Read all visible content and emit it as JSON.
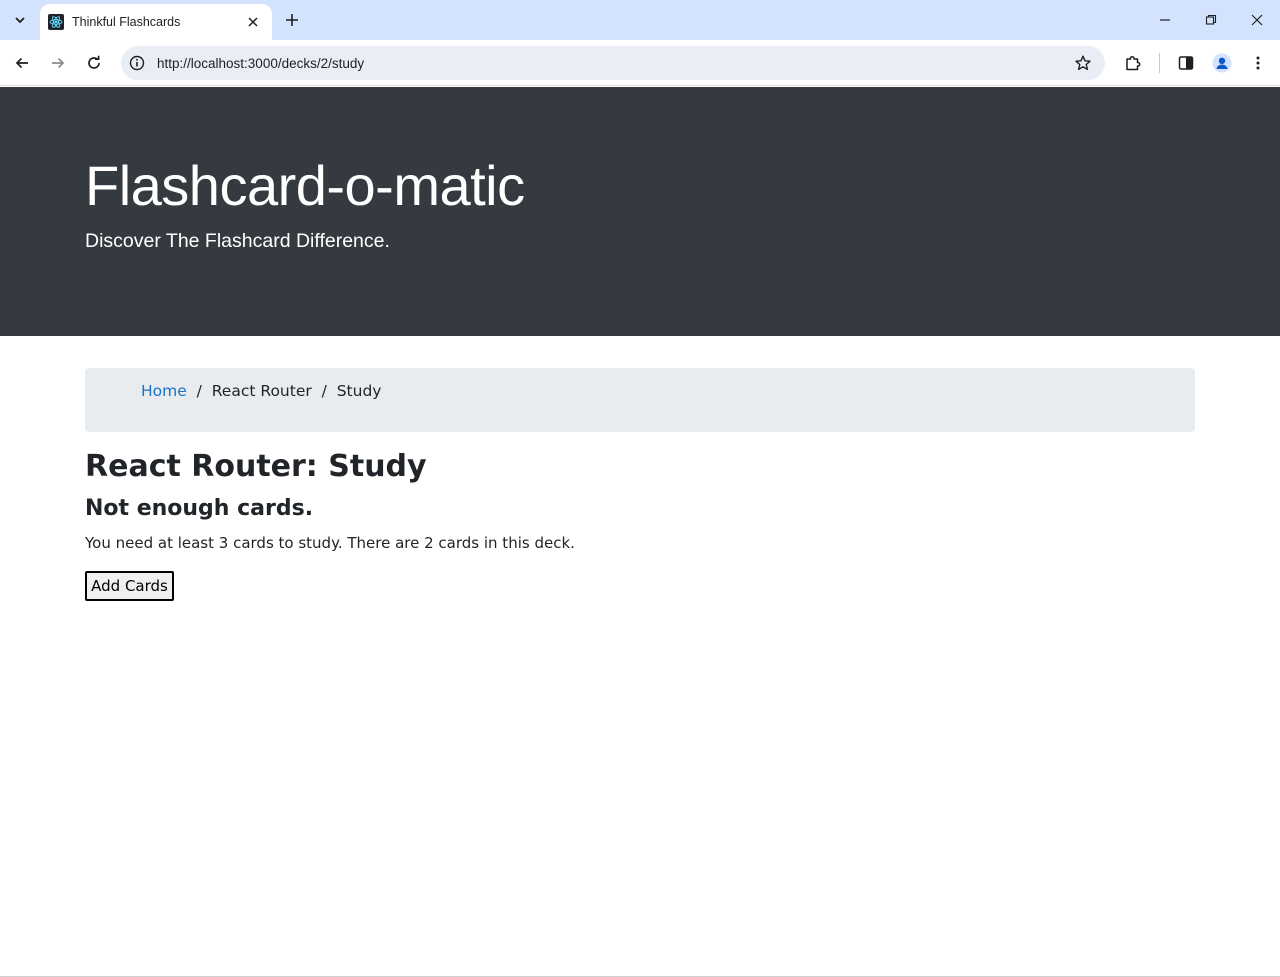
{
  "browser": {
    "tab_title": "Thinkful Flashcards",
    "url": "http://localhost:3000/decks/2/study",
    "icons": {
      "tab_search": "chevron-down-icon",
      "favicon": "react-logo-icon",
      "tab_close": "close-icon",
      "new_tab": "plus-icon",
      "back": "back-arrow-icon",
      "forward": "forward-arrow-icon",
      "reload": "reload-icon",
      "site_info": "info-icon",
      "bookmark": "star-icon",
      "extensions": "puzzle-icon",
      "side_panel": "side-panel-icon",
      "profile": "profile-icon",
      "menu": "kebab-menu-icon"
    }
  },
  "header": {
    "title": "Flashcard-o-matic",
    "lead": "Discover The Flashcard Difference."
  },
  "breadcrumb": {
    "home": "Home",
    "separator": "/",
    "deck": "React Router",
    "current": "Study"
  },
  "main": {
    "title": "React Router: Study",
    "subtitle": "Not enough cards.",
    "message": "You need at least 3 cards to study. There are 2 cards in this deck.",
    "add_button": "Add Cards"
  },
  "colors": {
    "tabbar_bg": "#d3e3fd",
    "jumbotron_bg": "#343a40",
    "breadcrumb_bg": "#e9ecef",
    "link": "#1a73c8"
  }
}
